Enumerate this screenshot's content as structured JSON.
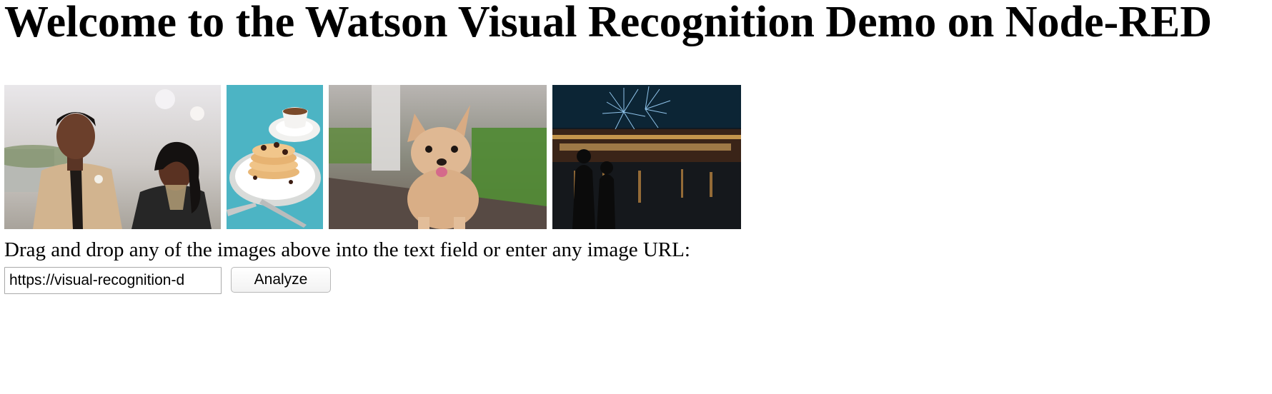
{
  "page": {
    "title": "Welcome to the Watson Visual Recognition Demo on Node-RED"
  },
  "gallery": {
    "images": [
      {
        "subject": "couple-photo"
      },
      {
        "subject": "pancakes-photo"
      },
      {
        "subject": "chihuahua-photo"
      },
      {
        "subject": "fireworks-photo"
      }
    ]
  },
  "instructions": {
    "text": "Drag and drop any of the images above into the text field or enter any image URL:"
  },
  "url_field": {
    "value": "https://visual-recognition-d"
  },
  "analyze_button": {
    "label": "Analyze"
  }
}
